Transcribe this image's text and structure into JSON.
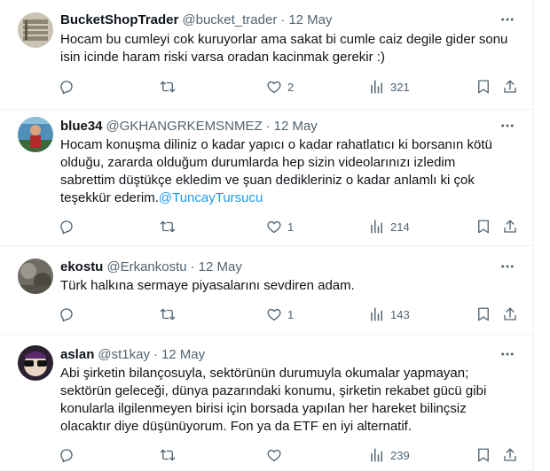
{
  "tweets": [
    {
      "name": "BucketShopTrader",
      "handle": "@bucket_trader",
      "sep": "·",
      "date": "12 May",
      "lines": [
        "Hocam bu cumleyi cok kuruyorlar ama sakat bi cumle caiz degile gider sonu",
        "isin icinde haram riski varsa oradan kacinmak gerekir :)"
      ],
      "mention": "",
      "reply_count": "",
      "retweet_count": "",
      "like_count": "2",
      "view_count": "321"
    },
    {
      "name": "blue34",
      "handle": "@GKHANGRKEMSNMEZ",
      "sep": "·",
      "date": "12 May",
      "lines": [
        "Hocam konuşma diliniz o kadar yapıcı o kadar rahatlatıcı ki borsanın kötü",
        "olduğu, zararda olduğum durumlarda hep sizin videolarınızı izledim",
        "sabrettim düştükçe ekledim ve şuan dedikleriniz o kadar anlamlı ki çok",
        "teşekkür ederim."
      ],
      "mention": "@TuncayTursucu",
      "reply_count": "",
      "retweet_count": "",
      "like_count": "1",
      "view_count": "214"
    },
    {
      "name": "ekostu",
      "handle": "@Erkankostu",
      "sep": "·",
      "date": "12 May",
      "lines": [
        "Türk halkına sermaye piyasalarını sevdiren adam."
      ],
      "mention": "",
      "reply_count": "",
      "retweet_count": "",
      "like_count": "1",
      "view_count": "143"
    },
    {
      "name": "aslan",
      "handle": "@st1kay",
      "sep": "·",
      "date": "12 May",
      "lines": [
        "Abi şirketin bilançosuyla, sektörünün durumuyla okumalar yapmayan;",
        "sektörün geleceği, dünya pazarındaki konumu, şirketin rekabet gücü gibi",
        "konularla ilgilenmeyen birisi için borsada yapılan her hareket bilinçsiz",
        "olacaktır diye düşünüyorum. Fon ya da ETF en iyi alternatif."
      ],
      "mention": "",
      "reply_count": "",
      "retweet_count": "",
      "like_count": "",
      "view_count": "239"
    }
  ],
  "icons": {
    "more": "more-horizontal-icon",
    "reply": "reply-icon",
    "retweet": "retweet-icon",
    "like": "heart-icon",
    "views": "views-chart-icon",
    "bookmark": "bookmark-icon",
    "share": "share-icon"
  },
  "colors": {
    "text": "#0f1419",
    "secondary": "#536471",
    "link": "#1d9bf0",
    "divider": "#eff3f4"
  }
}
